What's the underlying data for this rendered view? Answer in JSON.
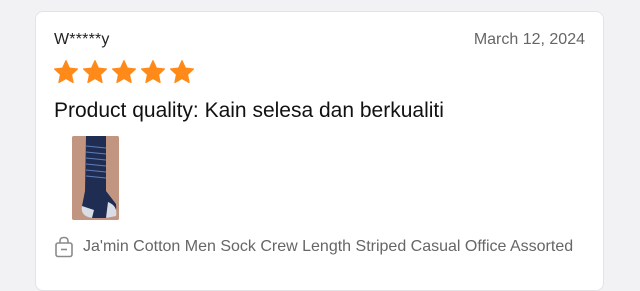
{
  "review": {
    "username": "W*****y",
    "date": "March 12, 2024",
    "rating": 5,
    "rating_max": 5,
    "text": "Product quality: Kain selesa dan berkualiti",
    "photo_icon": "sock-photo",
    "product_icon": "shopping-bag-icon",
    "product_name": "Ja'min Cotton Men Sock Crew Length Striped Casual Office Assorted"
  },
  "colors": {
    "star": "#ff8a1a",
    "date_text": "#666666",
    "card_border": "#e3e3e6"
  }
}
